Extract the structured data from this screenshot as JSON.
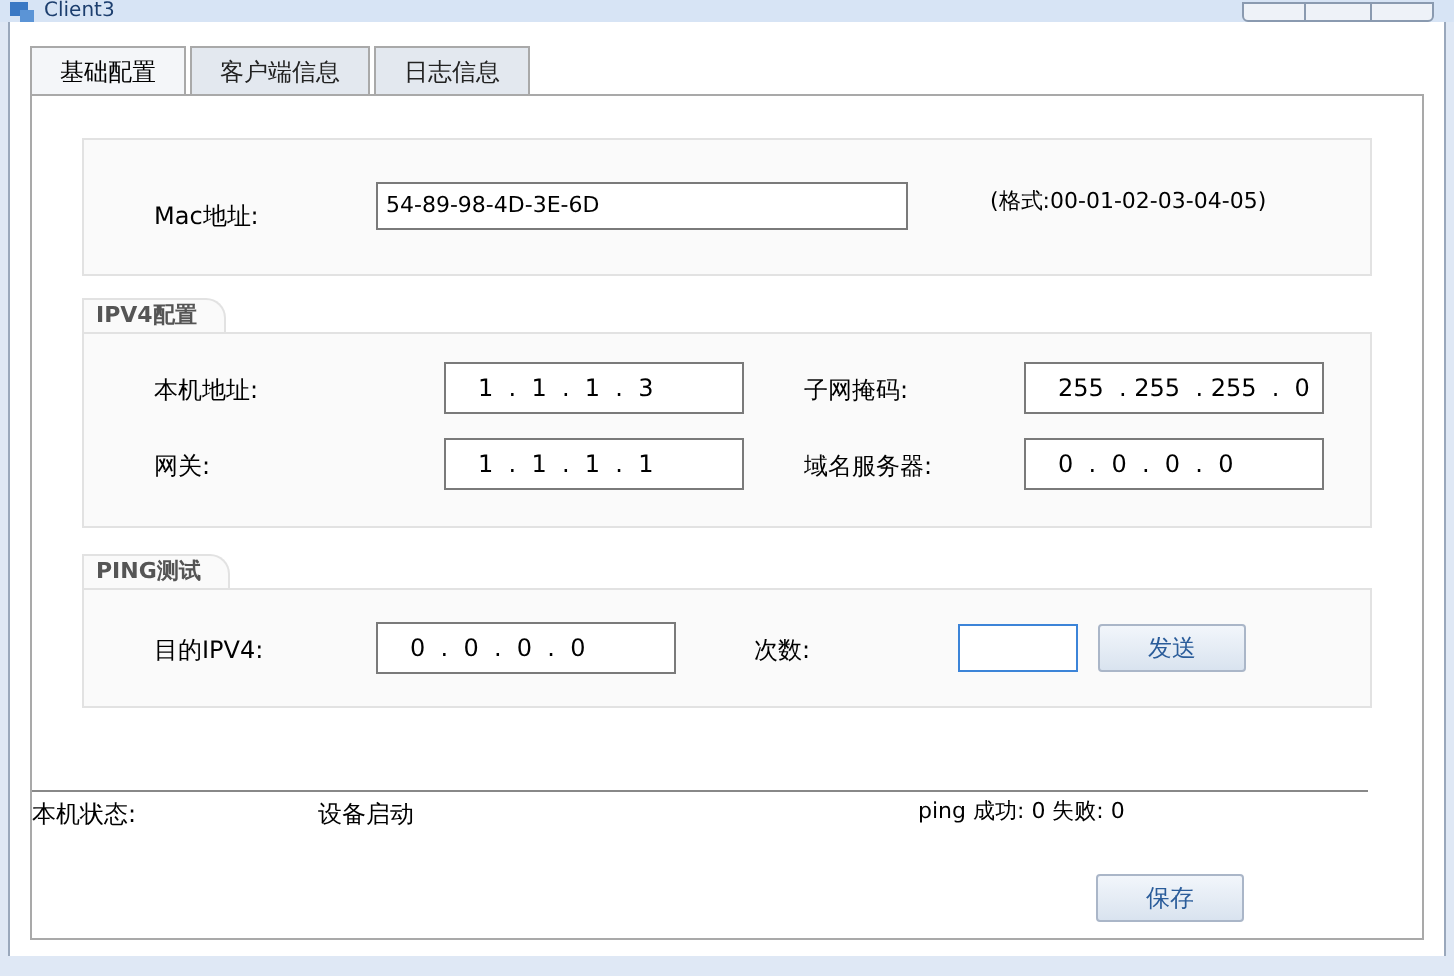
{
  "window": {
    "title": "Client3"
  },
  "tabs": [
    {
      "label": "基础配置",
      "selected": true
    },
    {
      "label": "客户端信息",
      "selected": false
    },
    {
      "label": "日志信息",
      "selected": false
    }
  ],
  "mac": {
    "label": "Mac地址:",
    "value": "54-89-98-4D-3E-6D",
    "hint": "(格式:00-01-02-03-04-05)"
  },
  "ipv4": {
    "title": "IPV4配置",
    "fields": [
      {
        "label": "本机地址:",
        "value": "1  .  1  .  1  .  3"
      },
      {
        "label": "子网掩码:",
        "value": "255  . 255  . 255  .  0"
      },
      {
        "label": "网关:",
        "value": "1  .  1  .  1  .  1"
      },
      {
        "label": "域名服务器:",
        "value": "0  .  0  .  0  .  0"
      }
    ]
  },
  "ping": {
    "title": "PING测试",
    "target_label": "目的IPV4:",
    "target_value": "0  .  0  .  0  .  0",
    "count_label": "次数:",
    "send_button": "发送"
  },
  "status": {
    "label": "本机状态:",
    "value": "设备启动",
    "result": "ping 成功: 0 失败: 0"
  },
  "save_button": "保存"
}
